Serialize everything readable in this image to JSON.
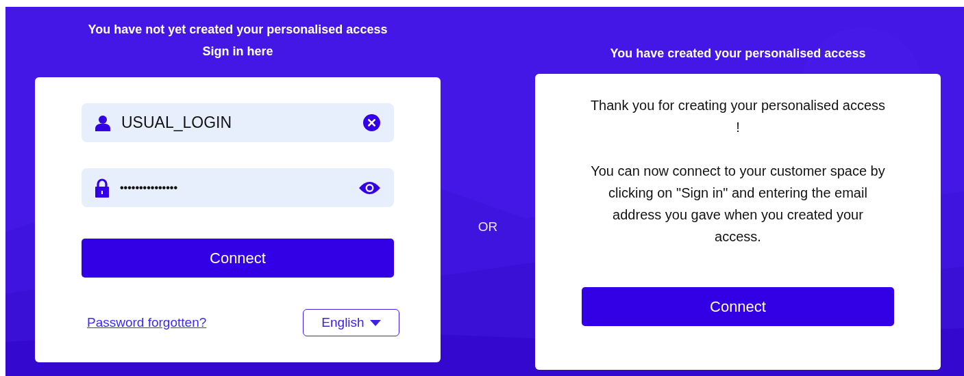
{
  "left": {
    "heading_lines": [
      "You have not yet created your personalised access",
      "Sign in here"
    ],
    "login_field": {
      "value": "USUAL_LOGIN"
    },
    "password_field": {
      "value": "•••••••••••••••"
    },
    "connect_button": "Connect",
    "forgot_link": "Password forgotten?",
    "language_select": {
      "value": "English"
    }
  },
  "separator": "OR",
  "right": {
    "heading": "You have created your personalised access",
    "paragraphs": [
      "Thank you for creating your personalised access !",
      "You can now connect to your customer space by clicking on \"Sign in\" and entering the email address you gave when you created your access."
    ],
    "connect_button": "Connect"
  }
}
